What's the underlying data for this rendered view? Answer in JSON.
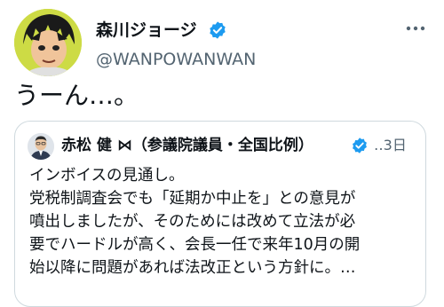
{
  "tweet": {
    "author_name": "森川ジョージ",
    "author_handle": "@WANPOWANWAN",
    "text": "うーん…。",
    "verified_icon": "verified-badge-icon",
    "more_icon": "more-options-icon"
  },
  "quote": {
    "author_name": "赤松 健 ⋈（参議院議員・全国比例）",
    "time": "‥3日",
    "verified_icon": "verified-badge-icon",
    "lines": [
      "インボイスの見通し。",
      "党税制調査会でも「延期か中止を」との意見が",
      "噴出しましたが、そのためには改めて立法が必",
      "要でハードルが高く、会長一任で来年10月の開",
      "始以降に問題があれば法改正という方針に。…"
    ]
  },
  "colors": {
    "text": "#0f1419",
    "secondary": "#536471",
    "verified": "#1d9bf0",
    "border": "#cfd9de"
  }
}
